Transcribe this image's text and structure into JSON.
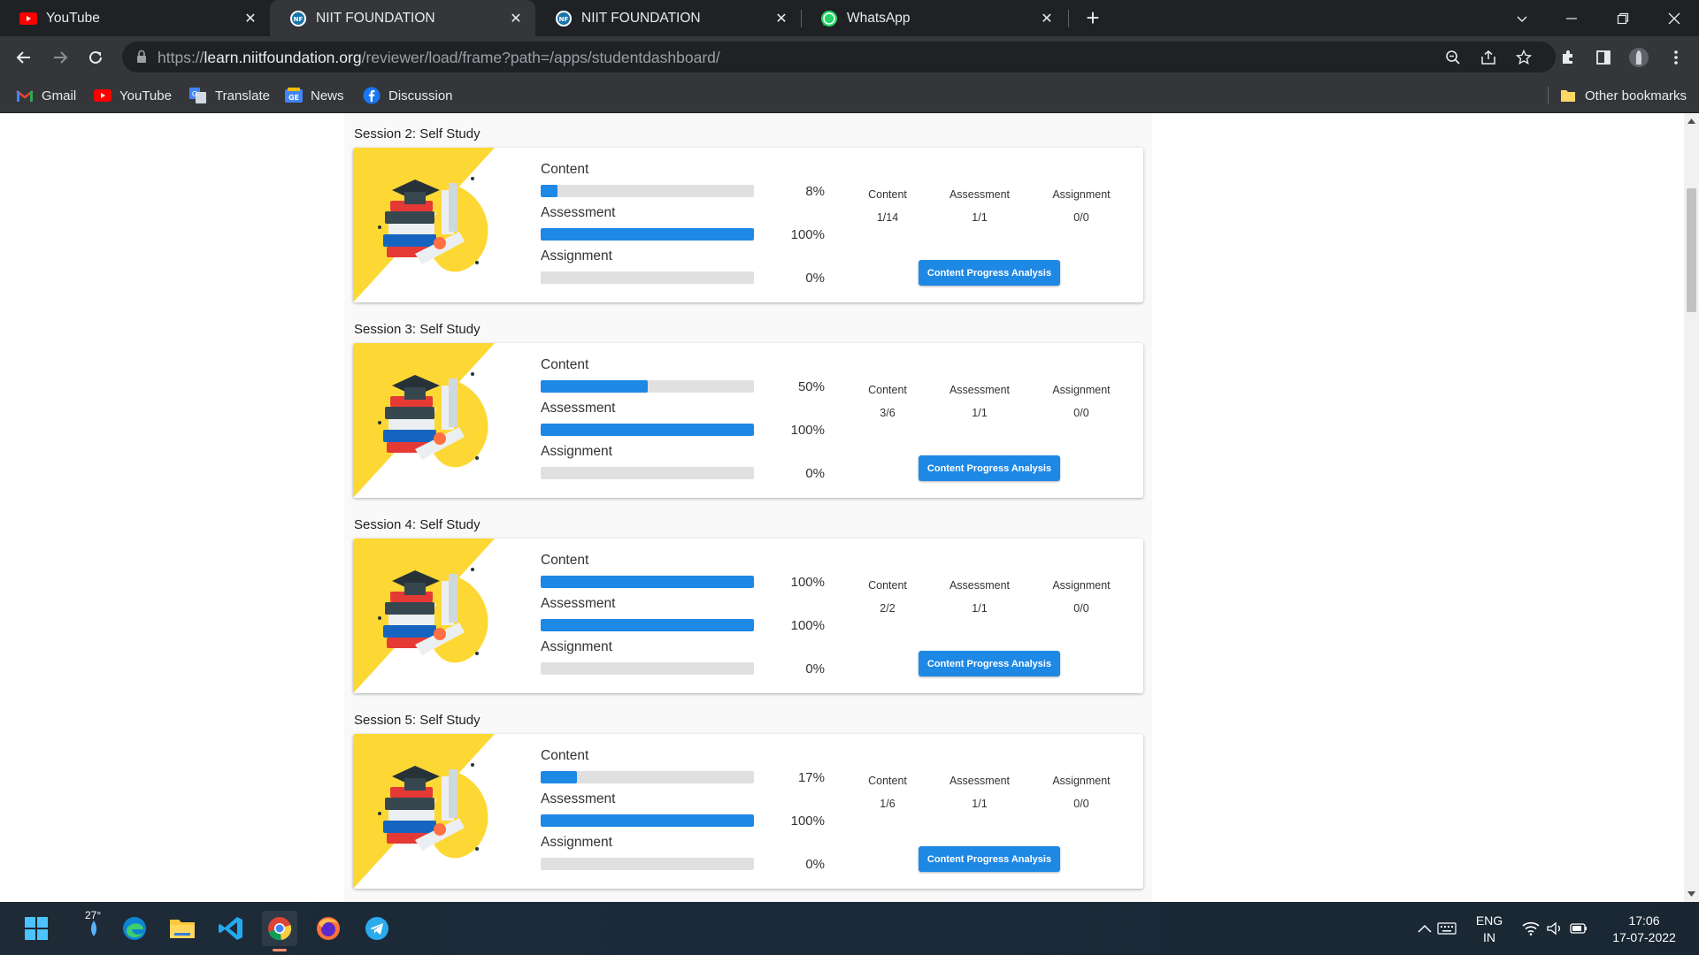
{
  "browser": {
    "tabs": [
      {
        "title": "YouTube",
        "icon": "youtube-icon"
      },
      {
        "title": "NIIT FOUNDATION",
        "icon": "niit-icon"
      },
      {
        "title": "NIIT FOUNDATION",
        "icon": "niit-icon"
      },
      {
        "title": "WhatsApp",
        "icon": "whatsapp-icon"
      }
    ],
    "url_prefix": "https://",
    "url_domain": "learn.niitfoundation.org",
    "url_path": "/reviewer/load/frame?path=/apps/studentdashboard/",
    "bookmarks": [
      {
        "label": "Gmail",
        "icon": "gmail-icon"
      },
      {
        "label": "YouTube",
        "icon": "youtube-icon"
      },
      {
        "label": "Translate",
        "icon": "translate-icon"
      },
      {
        "label": "News",
        "icon": "news-icon"
      },
      {
        "label": "Discussion",
        "icon": "facebook-icon"
      }
    ],
    "other_bookmarks": "Other bookmarks"
  },
  "sessions": [
    {
      "title": "Session 2: Self Study",
      "bars": [
        {
          "label": "Content",
          "pct_text": "8%",
          "fill": 0.08
        },
        {
          "label": "Assessment",
          "pct_text": "100%",
          "fill": 1.0
        },
        {
          "label": "Assignment",
          "pct_text": "0%",
          "fill": 0.0
        }
      ],
      "stats": [
        {
          "head": "Content",
          "value": "1/14"
        },
        {
          "head": "Assessment",
          "value": "1/1"
        },
        {
          "head": "Assignment",
          "value": "0/0"
        }
      ],
      "button": "Content Progress Analysis"
    },
    {
      "title": "Session 3: Self Study",
      "bars": [
        {
          "label": "Content",
          "pct_text": "50%",
          "fill": 0.5
        },
        {
          "label": "Assessment",
          "pct_text": "100%",
          "fill": 1.0
        },
        {
          "label": "Assignment",
          "pct_text": "0%",
          "fill": 0.0
        }
      ],
      "stats": [
        {
          "head": "Content",
          "value": "3/6"
        },
        {
          "head": "Assessment",
          "value": "1/1"
        },
        {
          "head": "Assignment",
          "value": "0/0"
        }
      ],
      "button": "Content Progress Analysis"
    },
    {
      "title": "Session 4: Self Study",
      "bars": [
        {
          "label": "Content",
          "pct_text": "100%",
          "fill": 1.0
        },
        {
          "label": "Assessment",
          "pct_text": "100%",
          "fill": 1.0
        },
        {
          "label": "Assignment",
          "pct_text": "0%",
          "fill": 0.0
        }
      ],
      "stats": [
        {
          "head": "Content",
          "value": "2/2"
        },
        {
          "head": "Assessment",
          "value": "1/1"
        },
        {
          "head": "Assignment",
          "value": "0/0"
        }
      ],
      "button": "Content Progress Analysis"
    },
    {
      "title": "Session 5: Self Study",
      "bars": [
        {
          "label": "Content",
          "pct_text": "17%",
          "fill": 0.17
        },
        {
          "label": "Assessment",
          "pct_text": "100%",
          "fill": 1.0
        },
        {
          "label": "Assignment",
          "pct_text": "0%",
          "fill": 0.0
        }
      ],
      "stats": [
        {
          "head": "Content",
          "value": "1/6"
        },
        {
          "head": "Assessment",
          "value": "1/1"
        },
        {
          "head": "Assignment",
          "value": "0/0"
        }
      ],
      "button": "Content Progress Analysis"
    }
  ],
  "taskbar": {
    "weather": "27°",
    "lang_top": "ENG",
    "lang_bottom": "IN",
    "time": "17:06",
    "date": "17-07-2022"
  },
  "colors": {
    "accent": "#1e88e5",
    "track": "#e0e0e0",
    "thumb_yellow": "#fdd835"
  }
}
